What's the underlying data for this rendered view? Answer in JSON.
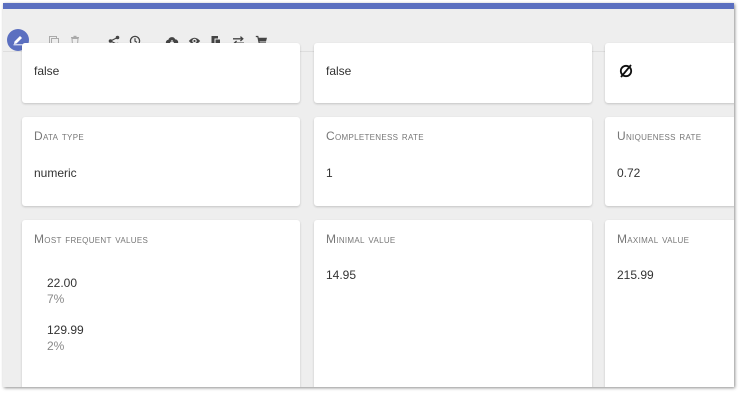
{
  "toolbar": {
    "icons": [
      "edit-icon",
      "copy-icon",
      "trash-icon",
      "share-icon",
      "history-icon",
      "cloud-download-icon",
      "eye-icon",
      "clipboard-icon",
      "swap-icon",
      "cart-icon"
    ],
    "accent": "#5b6fc0"
  },
  "row1": {
    "card1_value": "false",
    "card2_value": "false",
    "card3_icon": "empty-set-icon"
  },
  "row2": {
    "data_type_label": "Data type",
    "data_type_value": "numeric",
    "completeness_label": "Completeness rate",
    "completeness_value": "1",
    "uniqueness_label": "Uniqueness rate",
    "uniqueness_value": "0.72"
  },
  "row3": {
    "frequent_label": "Most frequent values",
    "frequent_values": [
      {
        "value": "22.00",
        "pct": "7%"
      },
      {
        "value": "129.99",
        "pct": "2%"
      }
    ],
    "minimal_label": "Minimal value",
    "minimal_value": "14.95",
    "maximal_label": "Maximal value",
    "maximal_value": "215.99"
  }
}
